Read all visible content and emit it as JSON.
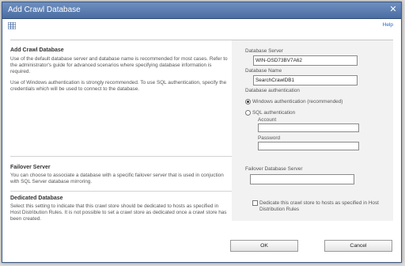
{
  "dialog": {
    "title": "Add Crawl Database",
    "close_glyph": "✕",
    "help_label": "Help"
  },
  "crawl_db": {
    "title": "Add Crawl Database",
    "desc1": "Use of the default database server and database name is recommended for most cases. Refer to the administrator's guide for advanced scenarios where specifying database information is required.",
    "desc2": "Use of Windows authentication is strongly recommended. To use SQL authentication, specify the credentials which will be used to connect to the database.",
    "db_server_label": "Database Server",
    "db_server_value": "WIN-OSD73BV7A62",
    "db_name_label": "Database Name",
    "db_name_value": "SearchCrawlDB1",
    "auth_label": "Database authentication",
    "auth_windows": "Windows authentication (recommended)",
    "auth_sql": "SQL authentication",
    "account_label": "Account",
    "password_label": "Password",
    "auth_selected": "windows"
  },
  "failover": {
    "title": "Failover Server",
    "desc": "You can choose to associate a database with a specific failover server that is used in conjuction with SQL Server database mirroring.",
    "field_label": "Failover Database Server",
    "value": ""
  },
  "dedicated": {
    "title": "Dedicated Database",
    "desc": "Select this setting to indicate that this crawl store should be dedicated to hosts as specified in Host Distribution Rules. It is not possible to set a crawl store as dedicated once a crawl store has been created.",
    "checkbox_label": "Dedicate this crawl store to hosts as specified in Host Distribution Rules",
    "checked": false
  },
  "buttons": {
    "ok": "OK",
    "cancel": "Cancel"
  },
  "colors": {
    "titlebar": "#5a7bb0",
    "help_link": "#2266cc"
  }
}
